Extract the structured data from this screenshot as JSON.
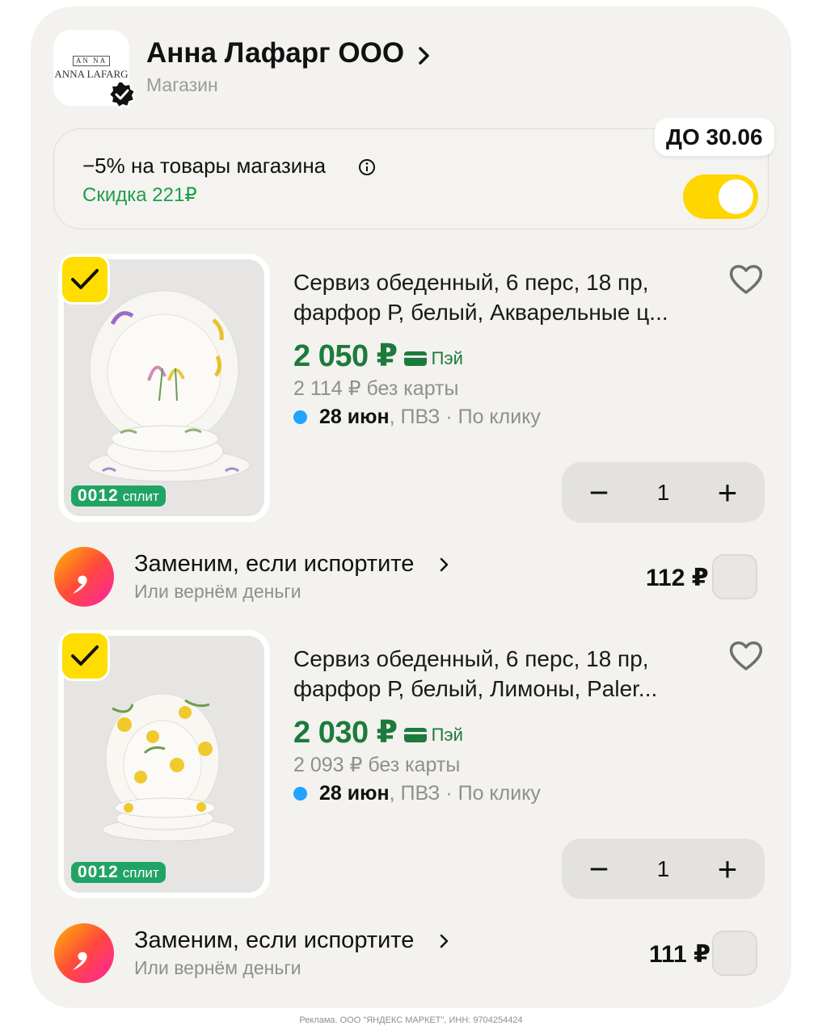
{
  "shop": {
    "logo_mono": "AN NA",
    "logo_text": "ANNA LAFARG",
    "name": "Анна Лафарг ООО",
    "type": "Магазин"
  },
  "discount": {
    "title": "−5% на товары магазина",
    "amount": "Скидка 221₽",
    "deadline": "ДО 30.06",
    "enabled": true
  },
  "products": [
    {
      "title": "Сервиз обеденный, 6 перс, 18 пр, фарфор Р, белый, Акварельные ц...",
      "price": "2 050 ₽",
      "pay_label": "Пэй",
      "old_price": "2 114 ₽ без карты",
      "delivery_date": "28 июн",
      "delivery_rest": ", ПВЗ · По клику",
      "split_num": "0012",
      "split_label": "сплит",
      "quantity": "1",
      "selected": true,
      "service": {
        "title": "Заменим, если испортите",
        "subtitle": "Или вернём деньги",
        "price": "112 ₽"
      }
    },
    {
      "title": "Сервиз обеденный, 6 перс, 18 пр, фарфор Р, белый, Лимоны, Paler...",
      "price": "2 030 ₽",
      "pay_label": "Пэй",
      "old_price": "2 093 ₽ без карты",
      "delivery_date": "28 июн",
      "delivery_rest": ", ПВЗ · По клику",
      "split_num": "0012",
      "split_label": "сплит",
      "quantity": "1",
      "selected": true,
      "service": {
        "title": "Заменим, если испортите",
        "subtitle": "Или вернём деньги",
        "price": "111 ₽"
      }
    }
  ],
  "stepper": {
    "minus": "−",
    "plus": "+"
  },
  "footer": "Реклама. ООО \"ЯНДЕКС МАРКЕТ\", ИНН: 9704254424",
  "colors": {
    "accent_yellow": "#ffdd00",
    "price_green": "#1d7a3c",
    "discount_green": "#1f9d49",
    "delivery_dot": "#1fa4ff"
  }
}
